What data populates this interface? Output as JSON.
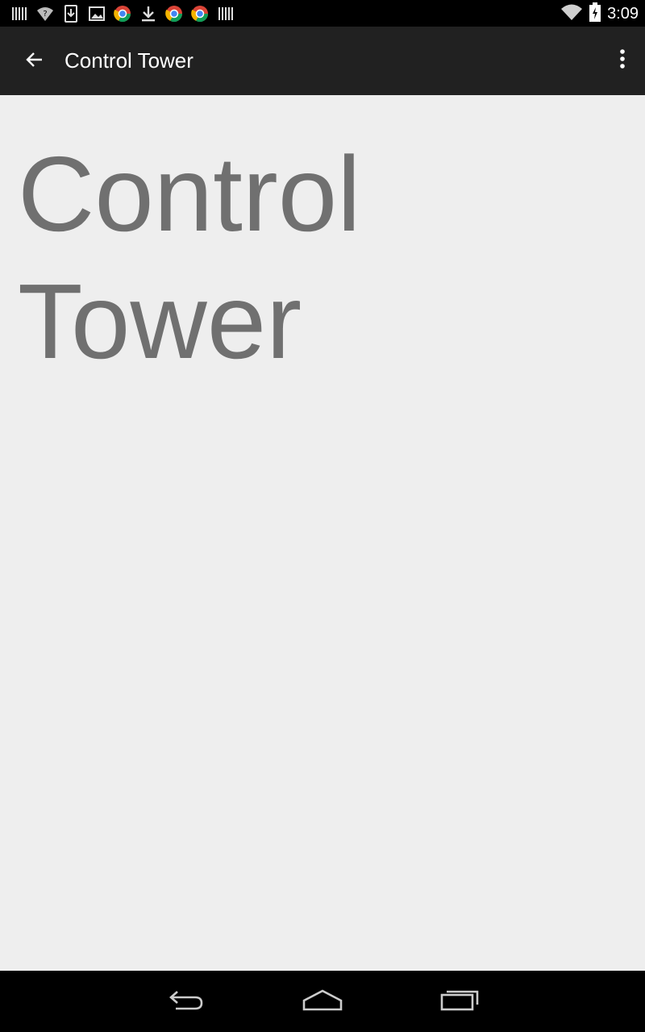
{
  "status_bar": {
    "time": "3:09",
    "icons": [
      "barcode-icon",
      "wifi-question-icon",
      "download-box-icon",
      "image-icon",
      "chrome-icon",
      "download-icon",
      "chrome-icon",
      "chrome-icon",
      "barcode-icon"
    ],
    "right_icons": [
      "wifi-signal-icon",
      "battery-charging-icon"
    ]
  },
  "action_bar": {
    "title": "Control Tower",
    "back_icon": "back-arrow-icon",
    "overflow_icon": "overflow-menu-icon"
  },
  "main": {
    "heading": "Control Tower"
  },
  "navigation": {
    "back": "nav-back-icon",
    "home": "nav-home-icon",
    "recents": "nav-recents-icon"
  },
  "colors": {
    "status_bar": "#000000",
    "action_bar": "#212121",
    "background": "#eeeeee",
    "heading_text": "#707070"
  }
}
